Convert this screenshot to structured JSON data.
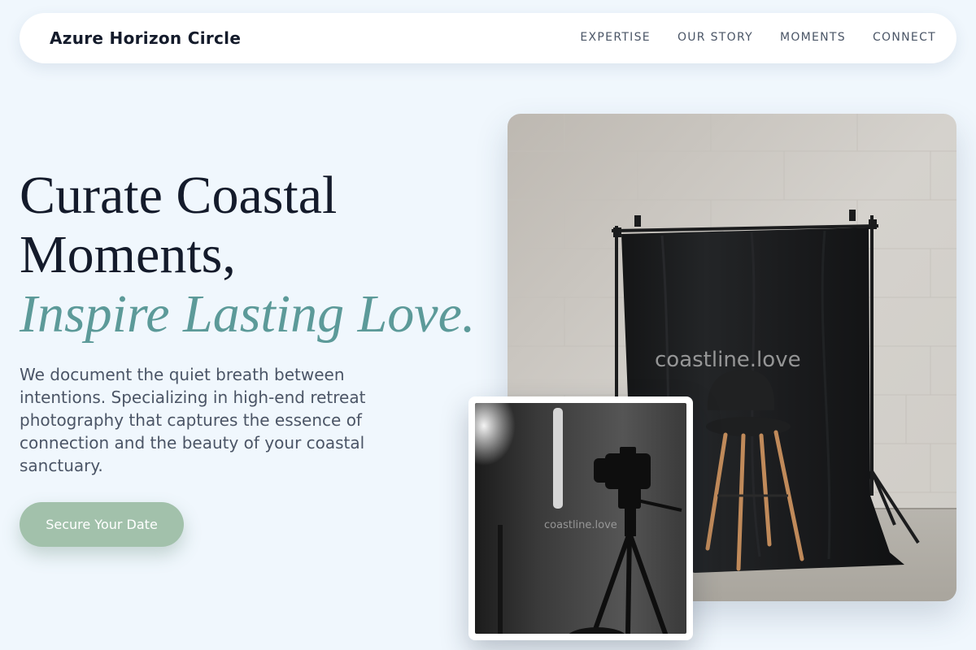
{
  "header": {
    "brand": "Azure Horizon Circle",
    "nav": [
      "EXPERTISE",
      "OUR STORY",
      "MOMENTS",
      "CONNECT"
    ]
  },
  "hero": {
    "headline_line1": "Curate Coastal",
    "headline_line2": "Moments,",
    "headline_accent": "Inspire Lasting Love.",
    "intro": "We document the quiet breath between intentions. Specializing in high-end retreat photography that captures the essence of connection and the beauty of your coastal sanctuary.",
    "cta_label": "Secure Your Date"
  },
  "images": {
    "main_watermark": "coastline.love",
    "detail_watermark": "coastline.love"
  },
  "colors": {
    "background": "#f0f7fd",
    "accent_text": "#5c9a99",
    "cta": "#a2c1ab",
    "heading": "#141b2b"
  }
}
